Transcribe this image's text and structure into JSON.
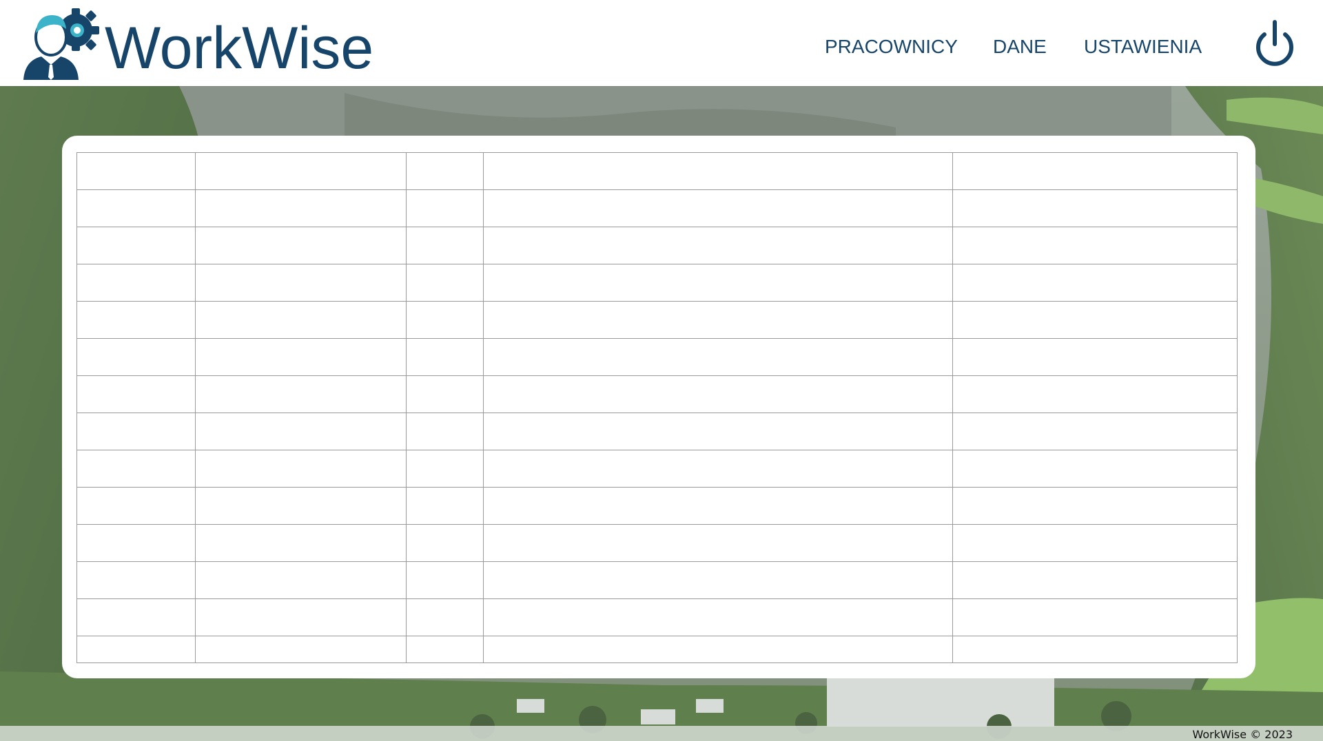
{
  "app": {
    "name": "WorkWise"
  },
  "header": {
    "logo_text": "WorkWise",
    "nav": [
      {
        "label": "PRACOWNICY"
      },
      {
        "label": "DANE"
      },
      {
        "label": "USTAWIENIA"
      }
    ],
    "power_icon": "power-icon"
  },
  "table": {
    "columns": 5,
    "rows": [
      [
        "",
        "",
        "",
        "",
        ""
      ],
      [
        "",
        "",
        "",
        "",
        ""
      ],
      [
        "",
        "",
        "",
        "",
        ""
      ],
      [
        "",
        "",
        "",
        "",
        ""
      ],
      [
        "",
        "",
        "",
        "",
        ""
      ],
      [
        "",
        "",
        "",
        "",
        ""
      ],
      [
        "",
        "",
        "",
        "",
        ""
      ],
      [
        "",
        "",
        "",
        "",
        ""
      ],
      [
        "",
        "",
        "",
        "",
        ""
      ],
      [
        "",
        "",
        "",
        "",
        ""
      ],
      [
        "",
        "",
        "",
        "",
        ""
      ],
      [
        "",
        "",
        "",
        "",
        ""
      ],
      [
        "",
        "",
        "",
        "",
        ""
      ],
      [
        "",
        "",
        "",
        "",
        ""
      ]
    ]
  },
  "footer": {
    "text": "WorkWise © 2023"
  },
  "colors": {
    "brand": "#17456a",
    "accent": "#3bb3c9"
  }
}
